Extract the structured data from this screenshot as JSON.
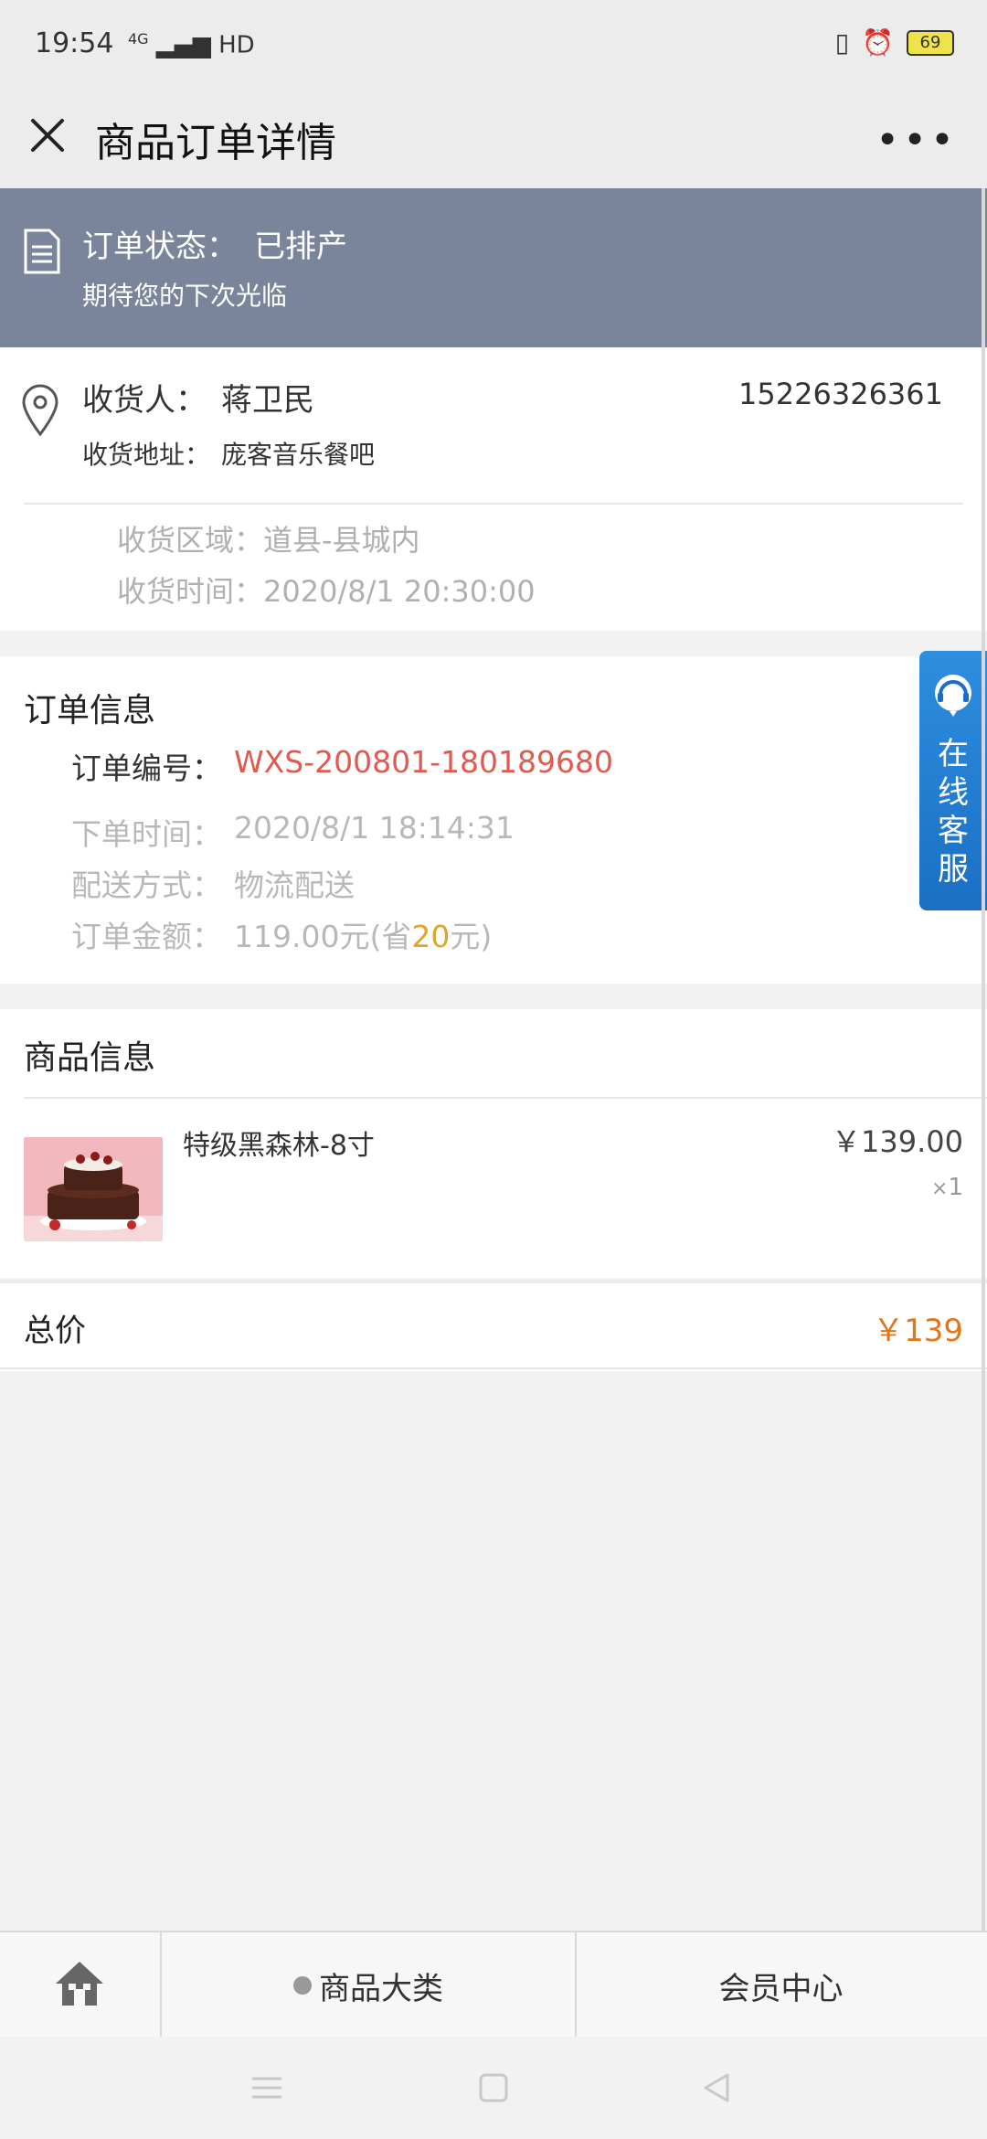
{
  "status_bar": {
    "time": "19:54",
    "network": "4G",
    "hd": "HD",
    "battery": "69"
  },
  "navbar": {
    "title": "商品订单详情",
    "more": "•••"
  },
  "order_status": {
    "label": "订单状态：",
    "value": "已排产",
    "subtitle": "期待您的下次光临"
  },
  "receiver": {
    "name_label": "收货人：",
    "name": "蒋卫民",
    "phone": "15226326361",
    "address_label": "收货地址：",
    "address": "庞客音乐餐吧",
    "area": "收货区域：道县-县城内",
    "time": "收货时间：2020/8/1 20:30:00"
  },
  "order_info": {
    "title": "订单信息",
    "number_label": "订单编号：",
    "number": "WXS-200801-180189680",
    "order_time_label": "下单时间：",
    "order_time": "2020/8/1 18:14:31",
    "delivery_label": "配送方式：",
    "delivery": "物流配送",
    "amount_label": "订单金额：",
    "amount_prefix": "119.00元(省",
    "amount_saved": "20",
    "amount_suffix": "元)"
  },
  "customer_service": {
    "label": "在线客服"
  },
  "goods": {
    "title": "商品信息",
    "items": [
      {
        "name": "特级黑森林-8寸",
        "price": "￥139.00",
        "qty_prefix": "×",
        "qty": "1"
      }
    ]
  },
  "total": {
    "label": "总价",
    "value": "￥139"
  },
  "tabbar": {
    "category": "商品大类",
    "member": "会员中心"
  },
  "colors": {
    "banner": "#7a849a",
    "order_no": "#e05a4f",
    "total": "#e0771e",
    "saved": "#e0a52c",
    "service": "#1a6fc4"
  }
}
